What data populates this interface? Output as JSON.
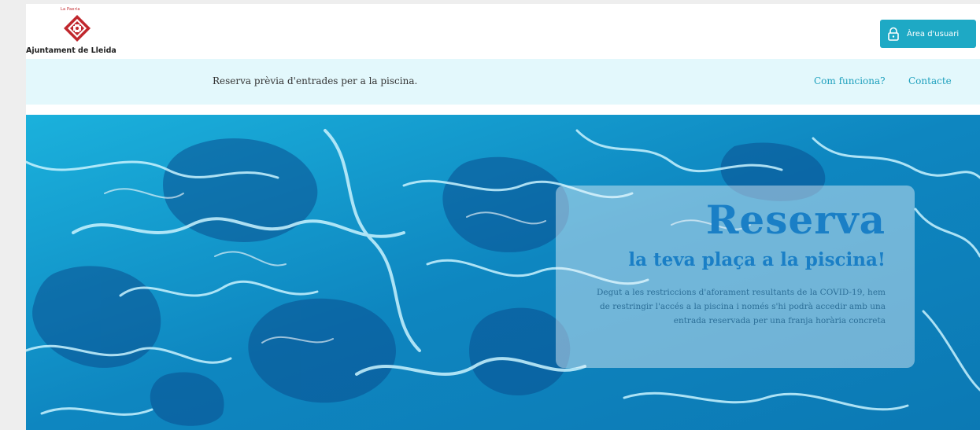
{
  "header": {
    "logo_superscript": "La Paeria",
    "logo_name": "Ajuntament de Lleida",
    "user_button_label": "Àrea d'usuari"
  },
  "nav": {
    "title": "Reserva prèvia d'entrades per a la piscina.",
    "links": [
      "Com funciona?",
      "Contacte"
    ]
  },
  "hero": {
    "title": "Reserva",
    "subtitle": "la teva plaça a la piscina!",
    "text": "Degut a les restriccions d'aforament resultants de la COVID-19, hem de restringir l'accés a la piscina i només s'hi podrà accedir amb una entrada reservada per una franja horària concreta"
  },
  "colors": {
    "accent": "#1ea9c5",
    "nav_background": "#e3f8fc",
    "title_blue": "#1a7fc6",
    "brand_red": "#c0272d"
  },
  "icons": [
    "paeria-logo-icon",
    "lock-icon"
  ]
}
